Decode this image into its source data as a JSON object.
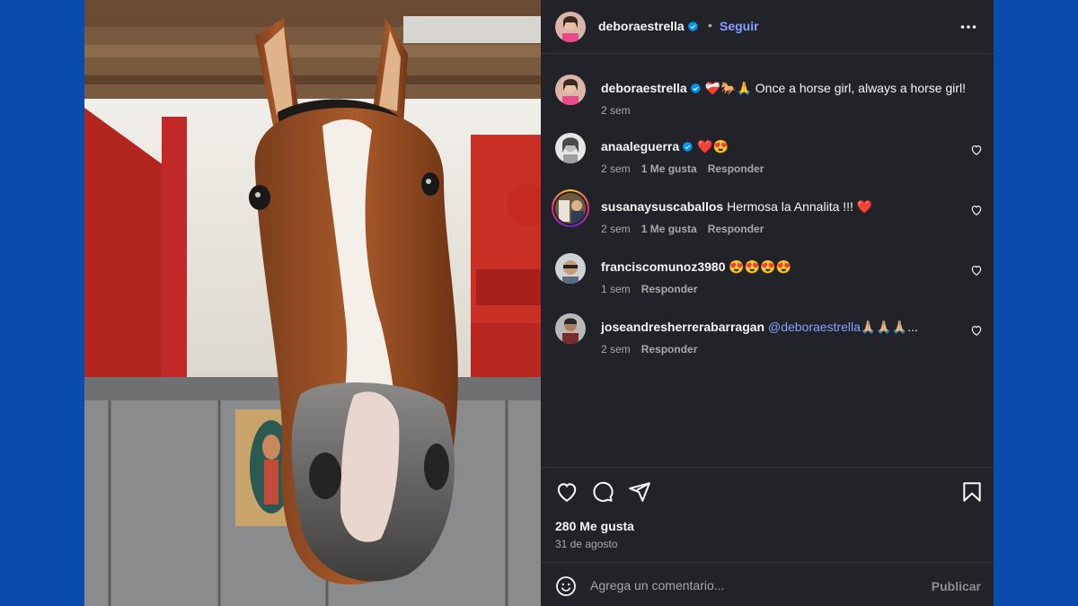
{
  "post": {
    "image_alt": "Horse close-up in stable",
    "author": {
      "username": "deboraestrella",
      "verified": true,
      "separator": "•",
      "follow_label": "Seguir"
    },
    "caption": {
      "username": "deboraestrella",
      "text": "❤️‍🩹🐎🙏 Once a horse girl, always a horse girl!",
      "time": "2 sem"
    },
    "comments": [
      {
        "username": "anaaleguerra",
        "verified": true,
        "text": "❤️😍",
        "time": "2 sem",
        "likes": "1 Me gusta",
        "reply": "Responder",
        "story_ring": false
      },
      {
        "username": "susanaysuscaballos",
        "verified": false,
        "text": "Hermosa la Annalita !!! ❤️",
        "time": "2 sem",
        "likes": "1 Me gusta",
        "reply": "Responder",
        "story_ring": true
      },
      {
        "username": "franciscomunoz3980",
        "verified": false,
        "text": "😍😍😍😍",
        "time": "1 sem",
        "likes": "",
        "reply": "Responder",
        "story_ring": false
      },
      {
        "username": "joseandresherrerabarragan",
        "verified": false,
        "mention": "@deboraestrella",
        "text": "🙏🏼🙏🏼🙏🏼...",
        "time": "2 sem",
        "likes": "",
        "reply": "Responder",
        "story_ring": false
      }
    ],
    "likes_label": "280 Me gusta",
    "date": "31 de agosto",
    "composer": {
      "placeholder": "Agrega un comentario...",
      "publish_label": "Publicar"
    }
  },
  "icons": {
    "verified": "verified-badge-icon",
    "more": "more-options-icon",
    "like": "heart-icon",
    "comment": "comment-icon",
    "share": "share-icon",
    "save": "bookmark-icon",
    "emoji": "emoji-icon"
  },
  "colors": {
    "page_background": "#0a4cad",
    "panel_background": "#212328",
    "link": "#85a1ff",
    "verified": "#0095f6"
  }
}
